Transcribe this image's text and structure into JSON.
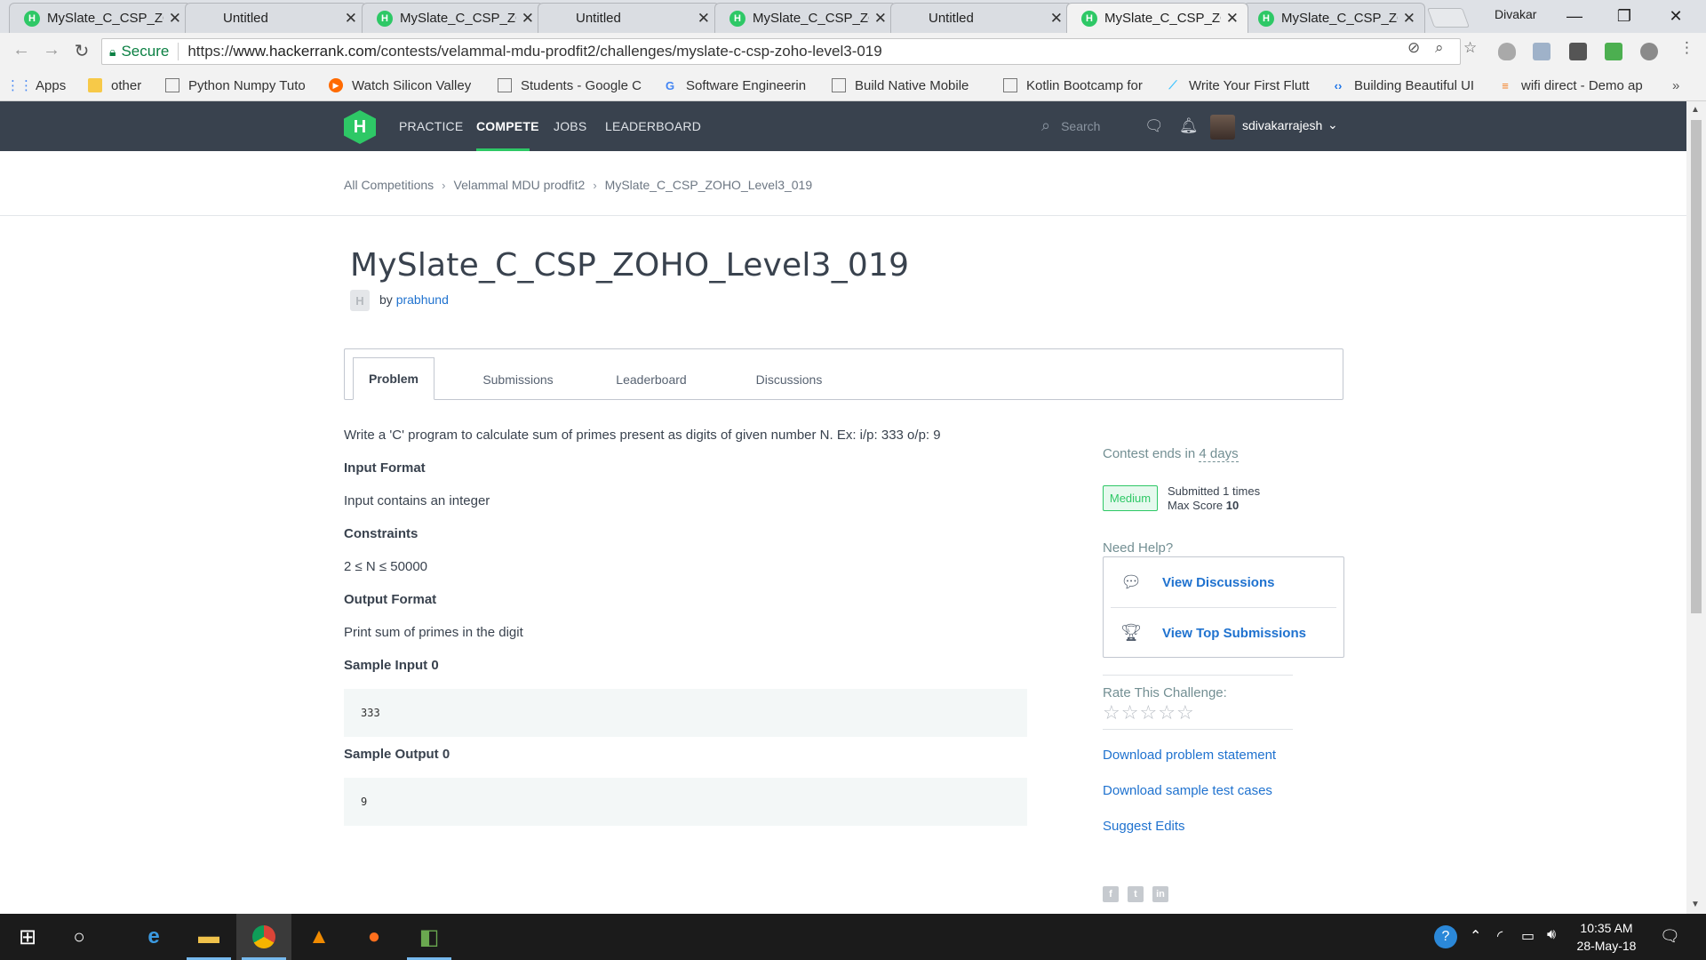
{
  "browser": {
    "tabs": [
      {
        "title": "MySlate_C_CSP_ZOHO",
        "favicon": "hackerrank-icon",
        "active": false
      },
      {
        "title": "Untitled",
        "favicon": "none",
        "active": false
      },
      {
        "title": "MySlate_C_CSP_ZOHO",
        "favicon": "hackerrank-icon",
        "active": false
      },
      {
        "title": "Untitled",
        "favicon": "none",
        "active": false
      },
      {
        "title": "MySlate_C_CSP_ZOHO",
        "favicon": "hackerrank-icon",
        "active": false
      },
      {
        "title": "Untitled",
        "favicon": "none",
        "active": false
      },
      {
        "title": "MySlate_C_CSP_ZOHO",
        "favicon": "hackerrank-icon",
        "active": true
      },
      {
        "title": "MySlate_C_CSP_ZOHO",
        "favicon": "hackerrank-icon",
        "active": false
      }
    ],
    "profile_name": "Divakar",
    "secure_label": "Secure",
    "url_scheme": "https://",
    "url_host": "www.hackerrank.com",
    "url_path": "/contests/velammal-mdu-prodfit2/challenges/myslate-c-csp-zoho-level3-019",
    "bookmarks": [
      {
        "label": "Apps",
        "icon": "apps-grid-icon"
      },
      {
        "label": "other",
        "icon": "folder-icon"
      },
      {
        "label": "Python Numpy Tuto",
        "icon": "page-icon"
      },
      {
        "label": "Watch Silicon Valley",
        "icon": "play-icon"
      },
      {
        "label": "Students - Google C",
        "icon": "page-icon"
      },
      {
        "label": "Software Engineerin",
        "icon": "google-icon"
      },
      {
        "label": "Build Native Mobile",
        "icon": "page-icon"
      },
      {
        "label": "Kotlin Bootcamp for",
        "icon": "page-icon"
      },
      {
        "label": "Write Your First Flutt",
        "icon": "flutter-icon"
      },
      {
        "label": "Building Beautiful UI",
        "icon": "code-icon"
      },
      {
        "label": "wifi direct - Demo ap",
        "icon": "stackoverflow-icon"
      }
    ]
  },
  "header": {
    "logo": "H",
    "nav": [
      "PRACTICE",
      "COMPETE",
      "JOBS",
      "LEADERBOARD"
    ],
    "active_nav": "COMPETE",
    "search_placeholder": "Search",
    "username": "sdivakarrajesh"
  },
  "breadcrumb": [
    "All Competitions",
    "Velammal MDU prodfit2",
    "MySlate_C_CSP_ZOHO_Level3_019"
  ],
  "challenge": {
    "title": "MySlate_C_CSP_ZOHO_Level3_019",
    "by_label": "by",
    "author": "prabhund",
    "tabs": [
      "Problem",
      "Submissions",
      "Leaderboard",
      "Discussions"
    ],
    "active_tab": "Problem",
    "statement": "Write a 'C' program to calculate sum of primes present as digits of given number N. Ex: i/p: 333 o/p: 9",
    "input_format_heading": "Input Format",
    "input_format": "Input contains an integer",
    "constraints_heading": "Constraints",
    "constraints": "2 ≤ N ≤ 50000",
    "output_format_heading": "Output Format",
    "output_format": "Print sum of primes in the digit",
    "sample_input_heading": "Sample Input 0",
    "sample_input": "333",
    "sample_output_heading": "Sample Output 0",
    "sample_output": "9"
  },
  "sidebar": {
    "contest_ends_prefix": "Contest ends in",
    "contest_ends_value": "4 days",
    "difficulty": "Medium",
    "submitted_label": "Submitted",
    "submitted_count": "1",
    "submitted_suffix": "times",
    "max_score_label": "Max Score",
    "max_score": "10",
    "need_help": "Need Help?",
    "help_links": [
      "View Discussions",
      "View Top Submissions"
    ],
    "rate_label": "Rate This Challenge:",
    "rating": 0,
    "rating_max": 5,
    "links": [
      "Download problem statement",
      "Download sample test cases",
      "Suggest Edits"
    ]
  },
  "taskbar": {
    "time": "10:35 AM",
    "date": "28-May-18"
  },
  "colors": {
    "hr_green": "#2ec866",
    "hr_nav_bg": "#39424e",
    "link_blue": "#1f72cf"
  }
}
